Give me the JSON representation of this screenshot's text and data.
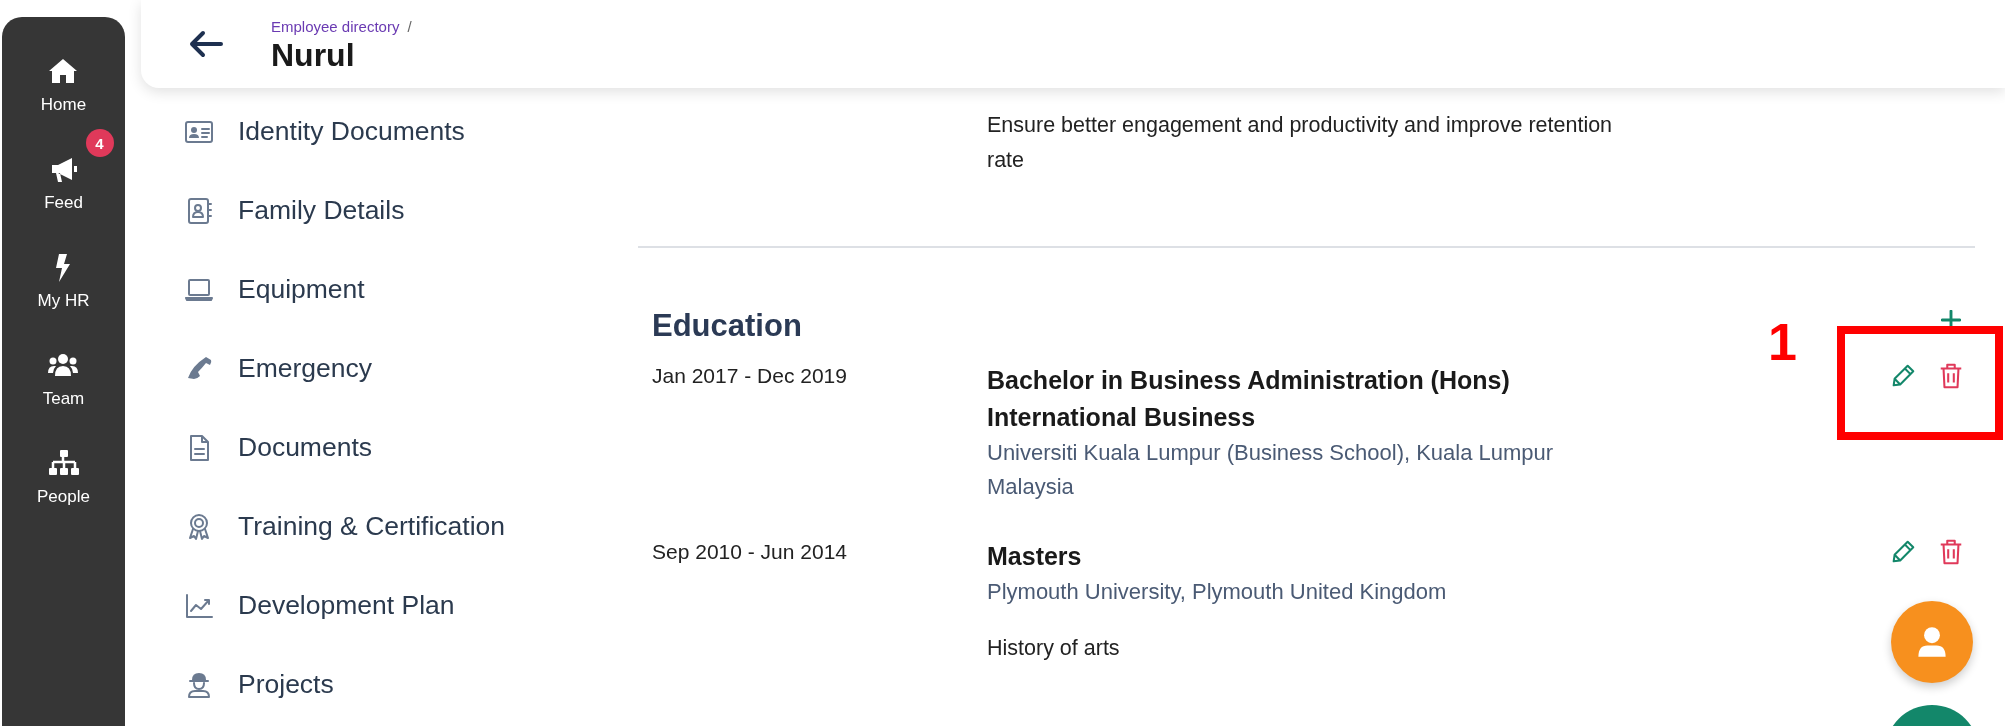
{
  "nav": [
    {
      "label": "Home"
    },
    {
      "label": "Feed",
      "badge": "4"
    },
    {
      "label": "My HR"
    },
    {
      "label": "Team"
    },
    {
      "label": "People"
    }
  ],
  "header": {
    "breadcrumb": "Employee directory",
    "separator": "/",
    "title": "Nurul"
  },
  "menu": [
    {
      "label": "Identity Documents"
    },
    {
      "label": "Family Details"
    },
    {
      "label": "Equipment"
    },
    {
      "label": "Emergency"
    },
    {
      "label": "Documents"
    },
    {
      "label": "Training & Certification"
    },
    {
      "label": "Development Plan"
    },
    {
      "label": "Projects"
    }
  ],
  "previous_entry": {
    "description": "Ensure better engagement and productivity and improve retention rate"
  },
  "education": {
    "title": "Education",
    "entries": [
      {
        "dates": "Jan 2017 - Dec 2019",
        "title": "Bachelor in Business Administration (Hons) International Business",
        "institution": "Universiti Kuala Lumpur (Business School), Kuala Lumpur Malaysia"
      },
      {
        "dates": "Sep 2010 - Jun 2014",
        "title": "Masters",
        "institution": "Plymouth University, Plymouth United Kingdom",
        "description": "History of arts"
      }
    ]
  },
  "annotation": {
    "label": "1"
  }
}
